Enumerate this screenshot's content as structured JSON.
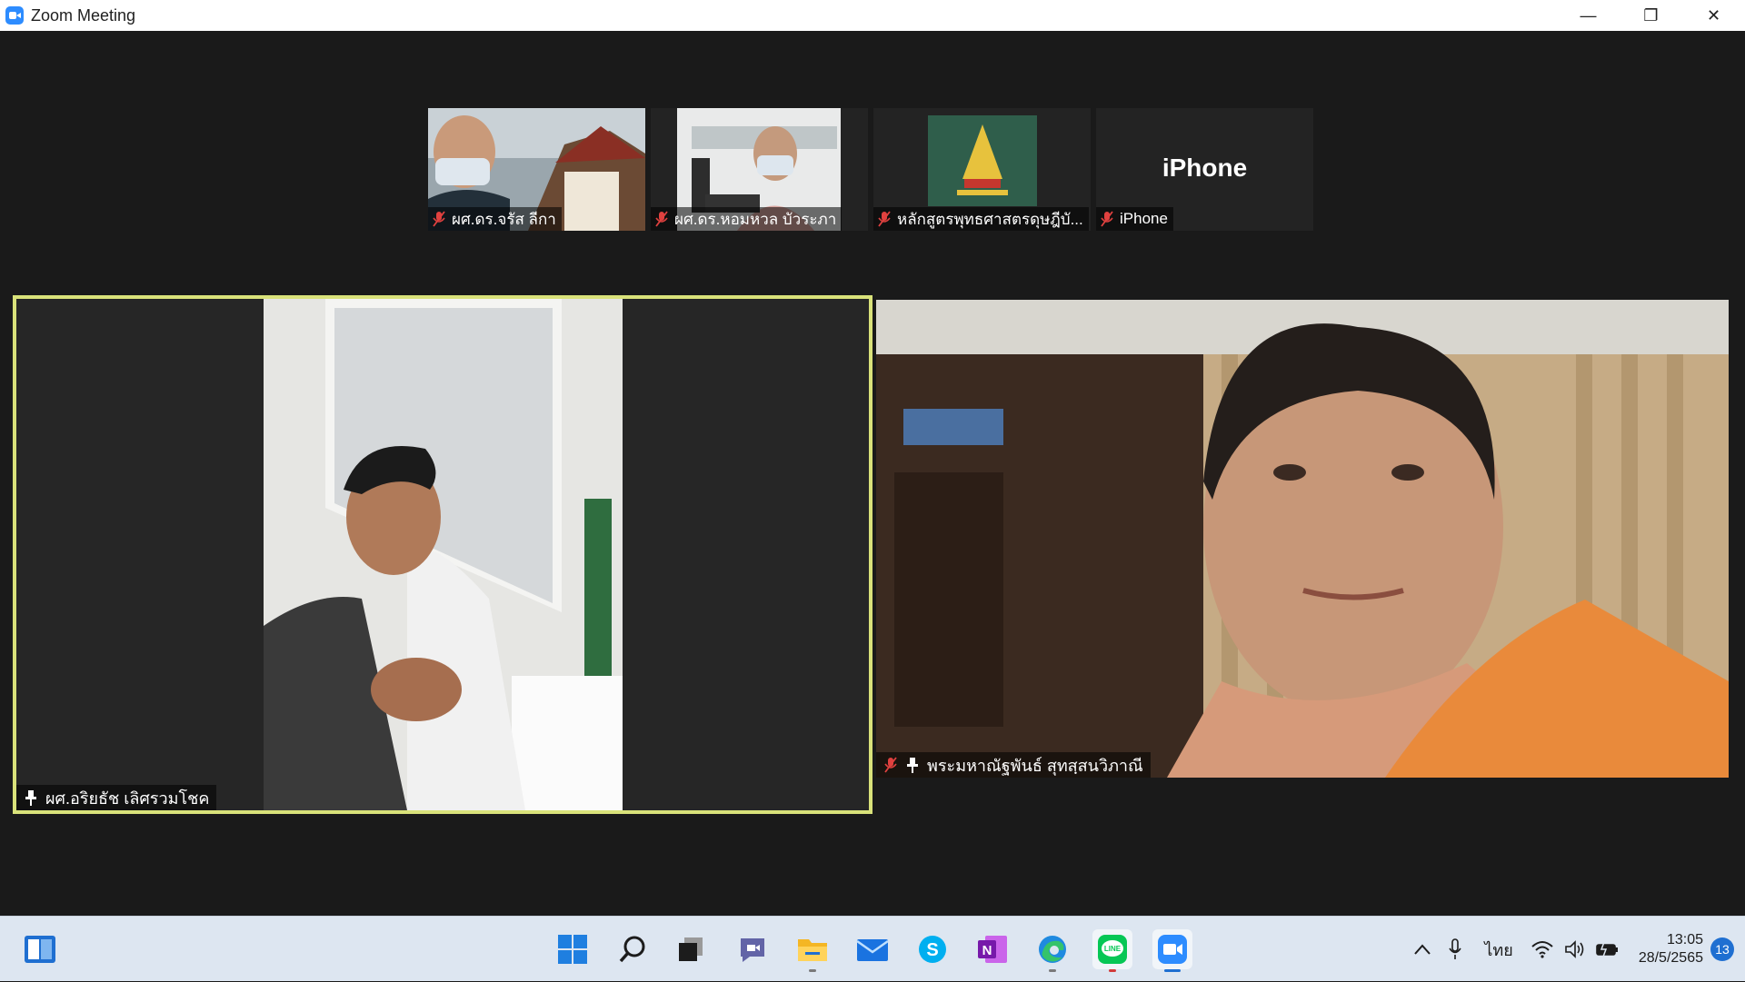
{
  "window": {
    "title": "Zoom Meeting",
    "minimize_glyph": "—",
    "restore_glyph": "❐",
    "close_glyph": "✕"
  },
  "thumbnails": [
    {
      "name": "ผศ.ดร.จรัส ลีกา",
      "muted": true
    },
    {
      "name": "ผศ.ดร.หอมหวล บัวระภา",
      "muted": true
    },
    {
      "name": "หลักสูตรพุทธศาสตรดุษฎีบั...",
      "muted": true
    },
    {
      "name": "iPhone",
      "display_name": "iPhone",
      "muted": true
    }
  ],
  "main_video": {
    "name": "ผศ.อริยธัช เลิศรวมโชค",
    "pinned": true,
    "speaking": true,
    "highlight_color": "#d9e27a"
  },
  "right_video": {
    "name": "พระมหาณัฐพันธ์ สุทสฺสนวิภาณี",
    "pinned": true,
    "muted": true
  },
  "taskbar": {
    "apps": [
      "widgets-icon",
      "start-icon",
      "search-icon",
      "task-view-icon",
      "teams-chat-icon",
      "file-explorer-icon",
      "mail-icon",
      "skype-icon",
      "onenote-icon",
      "edge-icon",
      "line-icon",
      "zoom-icon"
    ],
    "onenote_letter": "N",
    "line_text": "LINE",
    "language": "ไทย",
    "time": "13:05",
    "date": "28/5/2565",
    "notifications": "13"
  },
  "colors": {
    "zoom_blue": "#2d8cff",
    "mute_red": "#e0413f",
    "taskbar_bg": "#dde6f1"
  }
}
